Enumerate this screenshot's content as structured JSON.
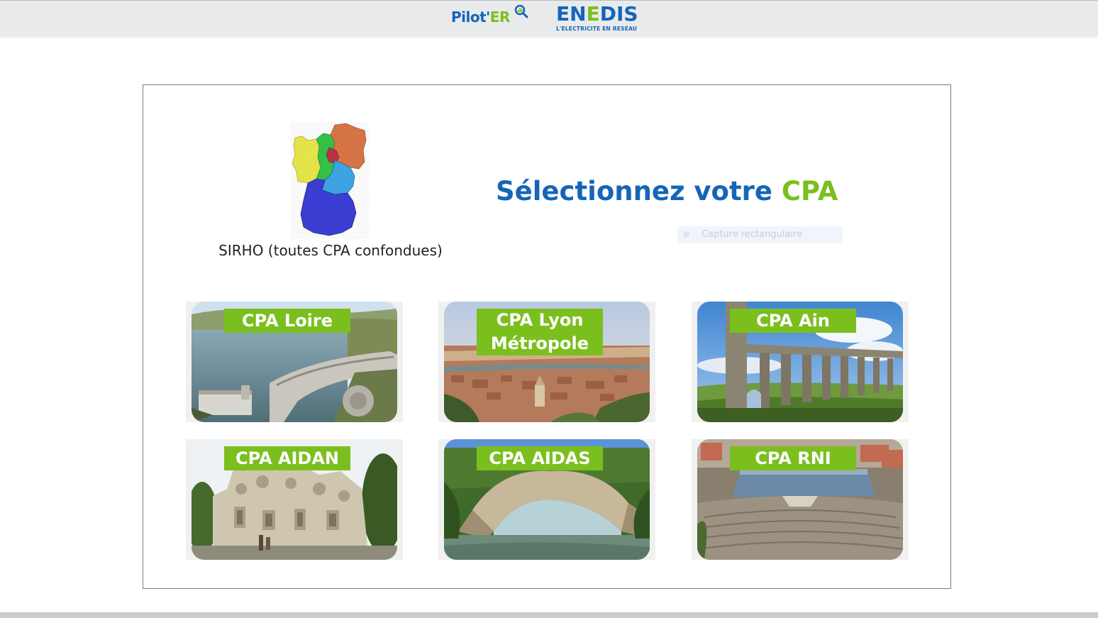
{
  "header": {
    "logo_piloter_main": "Pilot'",
    "logo_piloter_accent": "ER",
    "logo_enedis_a": "EN",
    "logo_enedis_b": "E",
    "logo_enedis_c": "DIS",
    "logo_enedis_tagline": "L'ELECTRICITE EN RESEAU"
  },
  "main": {
    "region_label": "SIRHO (toutes CPA confondues)",
    "headline_main": "Sélectionnez votre",
    "headline_accent": "CPA",
    "capture_label": "Capture rectangulaire"
  },
  "tiles": [
    {
      "label": "CPA Loire",
      "icon": "dam-lake-photo"
    },
    {
      "label": "CPA Lyon Métropole",
      "icon": "city-view-photo"
    },
    {
      "label": "CPA Ain",
      "icon": "aqueduct-photo"
    },
    {
      "label": "CPA AIDAN",
      "icon": "palace-photo"
    },
    {
      "label": "CPA AIDAS",
      "icon": "rock-arch-photo"
    },
    {
      "label": "CPA RNI",
      "icon": "amphitheater-photo"
    }
  ],
  "colors": {
    "brand_blue": "#1565b8",
    "brand_green": "#7bbf1e",
    "region_yellow": "#e9e84a",
    "region_green": "#35c44a",
    "region_orange": "#d97645",
    "region_red": "#c0304a",
    "region_light_blue": "#3ea6e8",
    "region_dark_blue": "#3b3fd6"
  }
}
